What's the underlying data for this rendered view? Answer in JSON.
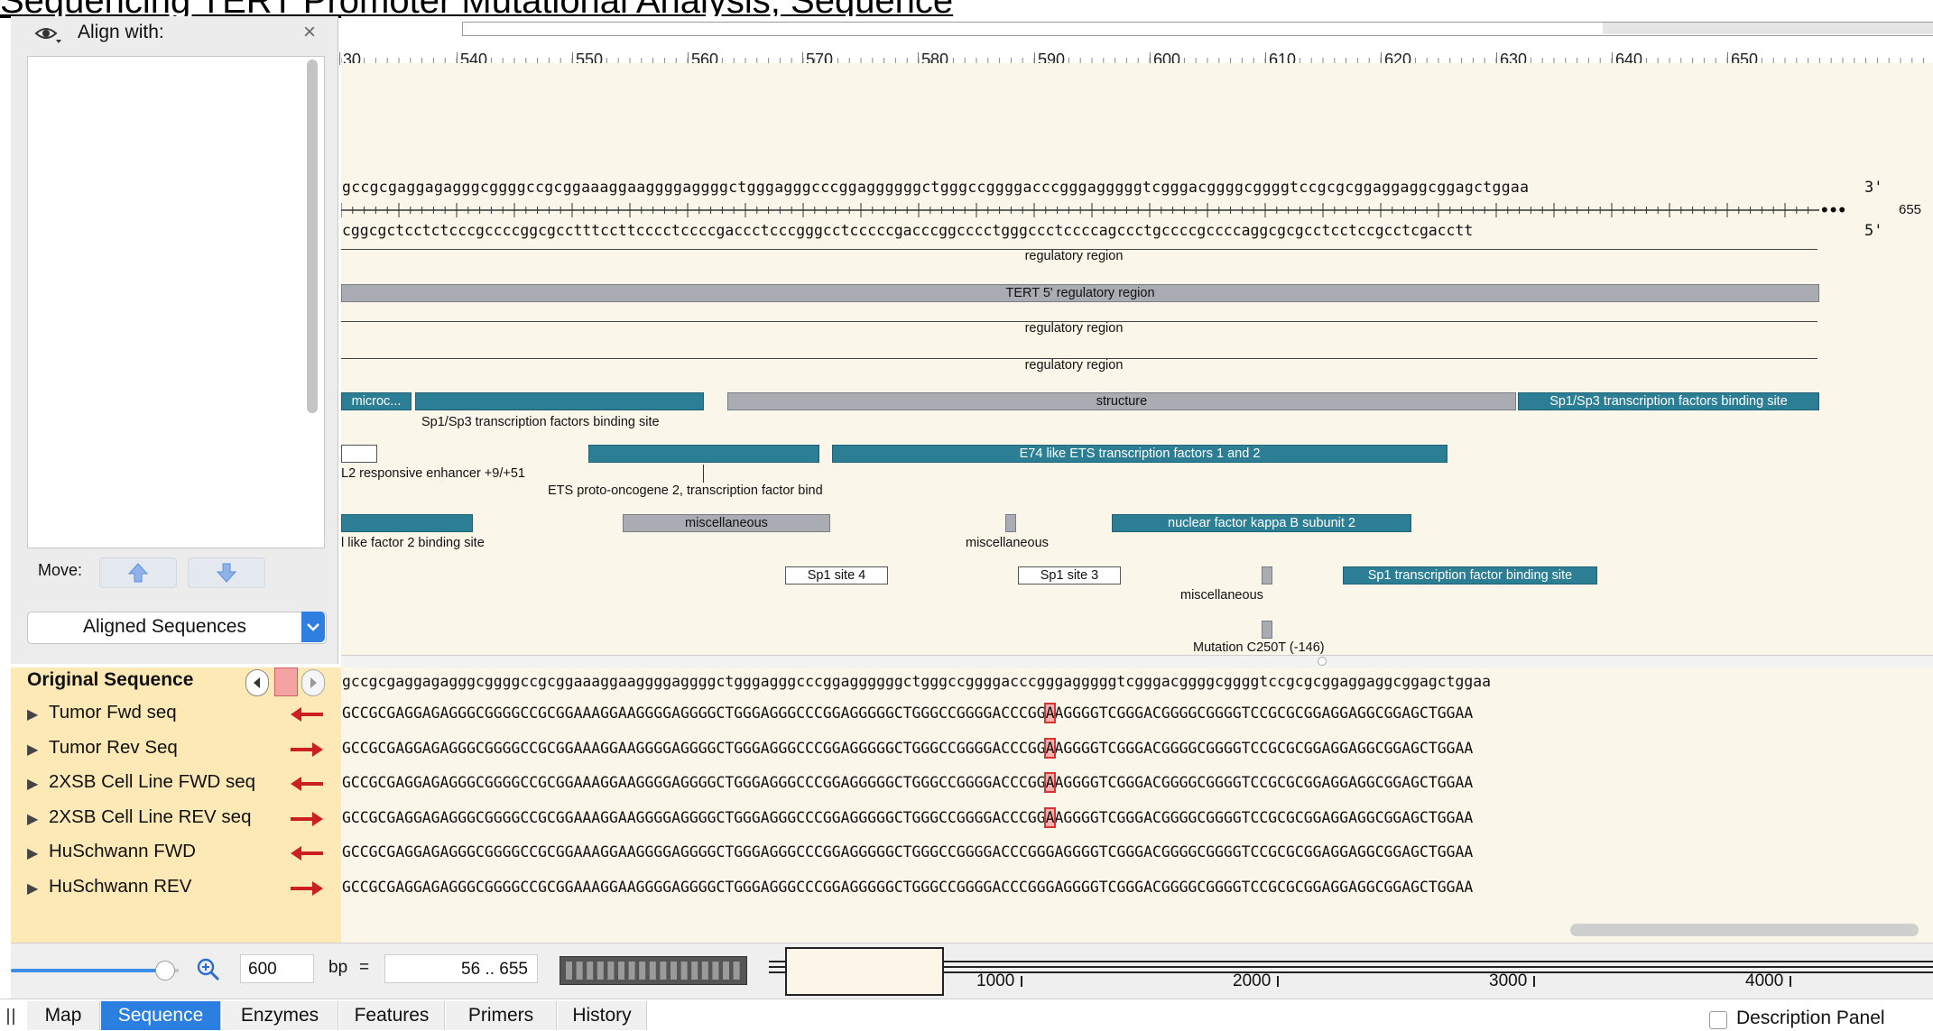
{
  "document_title": "Sequencing TERT Promoter Mutational Analysis, Sequence",
  "align_panel": {
    "title": "Align with:",
    "move_label": "Move:",
    "aligned_dropdown": "Aligned Sequences"
  },
  "ruler": {
    "ticks": [
      "30",
      "540",
      "550",
      "560",
      "570",
      "580",
      "590",
      "600",
      "610",
      "620",
      "630",
      "640",
      "650"
    ]
  },
  "sequence": {
    "top_strand": "gccgcgaggagagggcggggccgcggaaaggaaggggaggggctgggagggcccggaggggggctgggccggggacccgggagggggtcgggacggggcggggtccgcgcggaggaggcggagctggaa",
    "bottom_strand": "cggcgctcctctcccgccccggcgcctttccttcccctccccgaccctcccgggcctcccccgacccggcccctgggccctccccagccctgccccgccccaggcgcgcctcctccgcctcgacctt",
    "three_prime": "3'",
    "five_prime": "5'",
    "end_position": "655"
  },
  "features": {
    "regulatory_region_1": "regulatory region",
    "tert_regulatory": "TERT 5' regulatory region",
    "regulatory_region_2": "regulatory region",
    "regulatory_region_3": "regulatory region",
    "microc": "microc...",
    "sp1sp3_left": "Sp1/Sp3 transcription factors binding site",
    "structure": "structure",
    "sp1sp3_right": "Sp1/Sp3 transcription factors binding site",
    "l2_enhancer": "L2 responsive enhancer +9/+51",
    "ets2": "ETS proto-oncogene 2, transcription factor bind",
    "e74": "E74 like ETS transcription factors 1 and 2",
    "l_like_factor": "l like factor 2 binding site",
    "misc_1": "miscellaneous",
    "misc_2": "miscellaneous",
    "nfkb": "nuclear factor kappa B subunit 2",
    "sp1_site4": "Sp1 site 4",
    "sp1_site3": "Sp1 site 3",
    "misc_3": "miscellaneous",
    "sp1_tf": "Sp1 transcription factor binding site",
    "mutation": "Mutation C250T (-146)"
  },
  "alignment": {
    "original_label": "Original Sequence",
    "original_seq": "gccgcgaggagagggcggggccgcggaaaggaaggggaggggctgggagggcccggaggggggctgggccggggacccgggagggggtcgggacggggcggggtccgcgcggaggaggcggagctggaa",
    "rows": [
      {
        "name": "Tumor Fwd seq",
        "direction": "left",
        "pre": "GCCGCGAGGAGAGGGCGGGGCCGCGGAAAGGAAGGGGAGGGGCTGGGAGGGCCCGGAGGGGGCTGGGCCGGGGACCCGG",
        "mut": "A",
        "post": "AGGGGTCGGGACGGGGCGGGGTCCGCGCGGAGGAGGCGGAGCTGGAA"
      },
      {
        "name": "Tumor Rev Seq",
        "direction": "right",
        "pre": "GCCGCGAGGAGAGGGCGGGGCCGCGGAAAGGAAGGGGAGGGGCTGGGAGGGCCCGGAGGGGGCTGGGCCGGGGACCCGG",
        "mut": "A",
        "post": "AGGGGTCGGGACGGGGCGGGGTCCGCGCGGAGGAGGCGGAGCTGGAA"
      },
      {
        "name": "2XSB Cell Line FWD seq",
        "direction": "left",
        "pre": "GCCGCGAGGAGAGGGCGGGGCCGCGGAAAGGAAGGGGAGGGGCTGGGAGGGCCCGGAGGGGGCTGGGCCGGGGACCCGG",
        "mut": "A",
        "post": "AGGGGTCGGGACGGGGCGGGGTCCGCGCGGAGGAGGCGGAGCTGGAA"
      },
      {
        "name": "2XSB Cell Line REV seq",
        "direction": "right",
        "pre": "GCCGCGAGGAGAGGGCGGGGCCGCGGAAAGGAAGGGGAGGGGCTGGGAGGGCCCGGAGGGGGCTGGGCCGGGGACCCGG",
        "mut": "A",
        "post": "AGGGGTCGGGACGGGGCGGGGTCCGCGCGGAGGAGGCGGAGCTGGAA"
      },
      {
        "name": "HuSchwann FWD",
        "direction": "left",
        "pre": "GCCGCGAGGAGAGGGCGGGGCCGCGGAAAGGAAGGGGAGGGGCTGGGAGGGCCCGGAGGGGGCTGGGCCGGGGACCCGGGAGGGGTCGGGACGGGGCGGGGTCCGCGCGGAGGAGGCGGAGCTGGAA",
        "mut": "",
        "post": ""
      },
      {
        "name": "HuSchwann REV",
        "direction": "right",
        "pre": "GCCGCGAGGAGAGGGCGGGGCCGCGGAAAGGAAGGGGAGGGGCTGGGAGGGCCCGGAGGGGGCTGGGCCGGGGACCCGGGAGGGGTCGGGACGGGGCGGGGTCCGCGCGGAGGAGGCGGAGCTGGAA",
        "mut": "",
        "post": ""
      }
    ]
  },
  "controls": {
    "bp_value": "600",
    "bp_label": "bp",
    "equals": "=",
    "range": "56 .. 655",
    "overview_ticks": [
      "1000",
      "2000",
      "3000",
      "4000"
    ]
  },
  "tabs": [
    "Map",
    "Sequence",
    "Enzymes",
    "Features",
    "Primers",
    "History"
  ],
  "active_tab": "Sequence",
  "description_panel": "Description Panel",
  "colors": {
    "accent": "#2a7fe0",
    "feature_teal": "#2b7e93",
    "feature_gray": "#a9adb3",
    "mutation": "#e03030",
    "direction_arrow": "#cc2020"
  }
}
